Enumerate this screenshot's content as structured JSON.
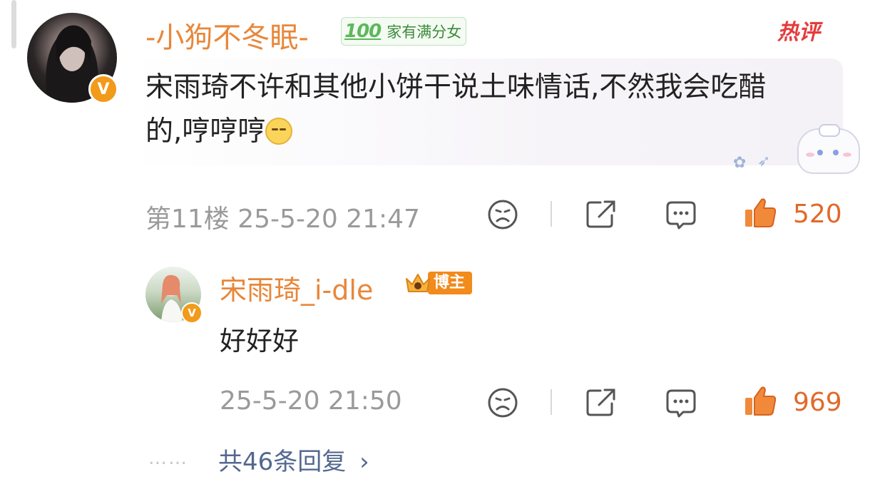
{
  "comment": {
    "username": "-小狗不冬眠-",
    "fan_badge": {
      "number": "100",
      "label": "家有满分女"
    },
    "hot_tag": "热评",
    "text_line1": "宋雨琦不许和其他小饼干说土味情话,不然我会吃醋",
    "text_line2": "的,哼哼哼",
    "floor_time": "第11楼 25-5-20 21:47",
    "likes": "520"
  },
  "reply": {
    "username": "宋雨琦_i-dle",
    "role_badge": "博主",
    "text": "好好好",
    "time": "25-5-20 21:50",
    "likes": "969"
  },
  "footer": {
    "dots": "……",
    "more_replies": "共46条回复",
    "chevron": "›"
  },
  "icons": {
    "dislike": "frown-face-icon",
    "share": "share-icon",
    "reply": "comment-bubble-icon",
    "like": "thumbs-up-icon",
    "verified": "verified-v-icon"
  },
  "colors": {
    "username": "#e8873a",
    "like": "#e06a2a",
    "hot": "#e43c3c",
    "link": "#54688f"
  }
}
